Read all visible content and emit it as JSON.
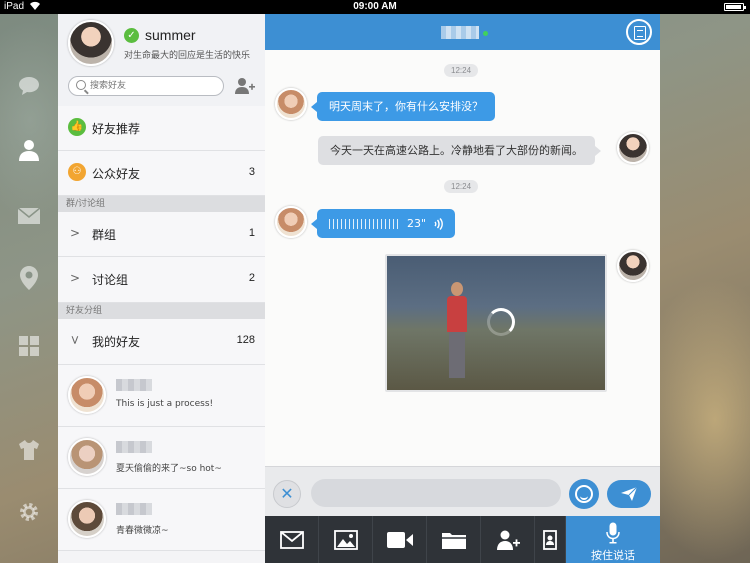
{
  "status_bar": {
    "carrier": "iPad",
    "time": "09:00 AM"
  },
  "profile": {
    "name": "summer",
    "motto": "对生命最大的回应是生活的快乐"
  },
  "search": {
    "placeholder": "搜索好友"
  },
  "menu": {
    "recommend": "好友推荐",
    "public": {
      "label": "公众好友",
      "count": "3"
    }
  },
  "sections": {
    "groups_header": "群/讨论组",
    "friends_header": "好友分组"
  },
  "groups": [
    {
      "label": "群组",
      "count": "1"
    },
    {
      "label": "讨论组",
      "count": "2"
    }
  ],
  "my_friends": {
    "label": "我的好友",
    "count": "128"
  },
  "friends": [
    {
      "message": "This is just a process!"
    },
    {
      "message": "夏天偷偷的来了~so hot~"
    },
    {
      "message": "青春微微凉~"
    }
  ],
  "chat": {
    "times": [
      "12:24",
      "12:24"
    ],
    "messages": [
      {
        "side": "in",
        "text": "明天周末了，你有什么安排没？"
      },
      {
        "side": "out",
        "text": "今天一天在高速公路上。冷静地看了大部份的新闻。"
      }
    ],
    "voice_duration": "23\""
  },
  "toolbar": {
    "voice_label": "按住说话"
  },
  "colors": {
    "accent": "#3d8fd3",
    "online": "#41d15c",
    "recommend_badge": "#5bbd3f",
    "public_badge": "#f2a531",
    "toolbar_bg": "#2f3338"
  }
}
